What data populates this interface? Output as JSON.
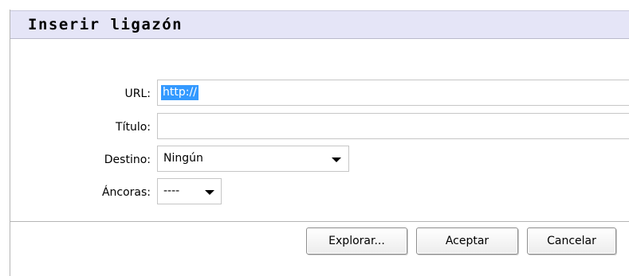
{
  "dialog": {
    "title": "Inserir ligazón"
  },
  "form": {
    "url_label": "URL:",
    "url_value": "http://",
    "title_label": "Título:",
    "title_value": "",
    "target_label": "Destino:",
    "target_selected": "Ningún",
    "anchors_label": "Áncoras:",
    "anchors_selected": "----"
  },
  "buttons": {
    "browse_label": "Explorar...",
    "accept_label": "Aceptar",
    "cancel_label": "Cancelar"
  },
  "icons": {
    "dropdown": "caret-down-icon"
  },
  "colors": {
    "title_bar": "#e5e5f7",
    "selection": "#3399ff"
  }
}
